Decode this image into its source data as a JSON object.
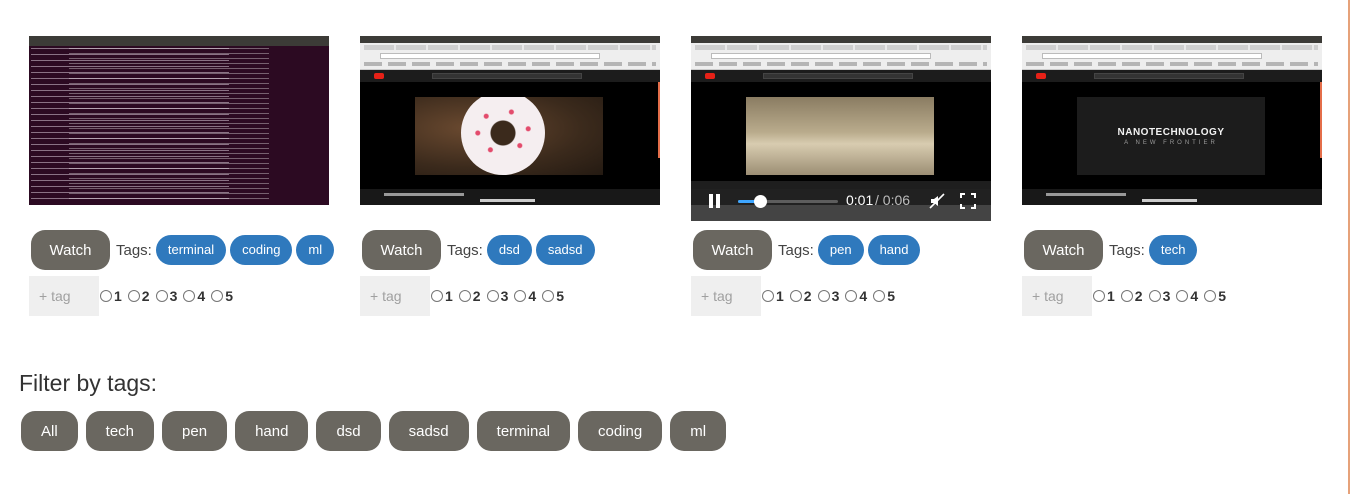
{
  "cards": [
    {
      "thumbnail": "terminal-screenshot",
      "watch_label": "Watch",
      "tags_label": "Tags:",
      "tags": [
        "terminal",
        "coding",
        "ml"
      ],
      "tag_placeholder": "+ tag",
      "ratings": [
        "1",
        "2",
        "3",
        "4",
        "5"
      ]
    },
    {
      "thumbnail": "youtube-donut-video",
      "watch_label": "Watch",
      "tags_label": "Tags:",
      "tags": [
        "dsd",
        "sadsd"
      ],
      "tag_placeholder": "+ tag",
      "ratings": [
        "1",
        "2",
        "3",
        "4",
        "5"
      ]
    },
    {
      "thumbnail": "youtube-blurred-video",
      "watch_label": "Watch",
      "tags_label": "Tags:",
      "tags": [
        "pen",
        "hand"
      ],
      "tag_placeholder": "+ tag",
      "ratings": [
        "1",
        "2",
        "3",
        "4",
        "5"
      ],
      "player": {
        "state": "playing",
        "current_time": "0:01",
        "total_time": "/ 0:06",
        "volume_fraction": 0.22,
        "muted": true
      }
    },
    {
      "thumbnail": "youtube-nanotechnology-video",
      "watch_label": "Watch",
      "tags_label": "Tags:",
      "tags": [
        "tech"
      ],
      "tag_placeholder": "+ tag",
      "ratings": [
        "1",
        "2",
        "3",
        "4",
        "5"
      ],
      "video_title_text": "NANOTECHNOLOGY",
      "video_subtitle_text": "A NEW FRONTIER"
    }
  ],
  "filter": {
    "title": "Filter by tags:",
    "buttons": [
      "All",
      "tech",
      "pen",
      "hand",
      "dsd",
      "sadsd",
      "terminal",
      "coding",
      "ml"
    ]
  },
  "colors": {
    "tag_pill": "#2f79bd",
    "button": "#6a6760",
    "accent_edge": "#e6a27a"
  }
}
